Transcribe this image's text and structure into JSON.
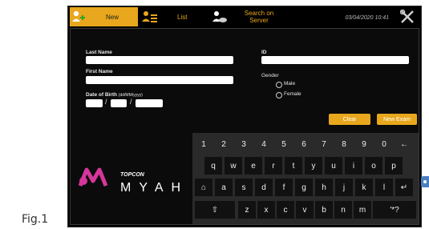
{
  "figure_label": "Fig.1",
  "tabs": [
    {
      "label": "New",
      "icon": "add-user-icon"
    },
    {
      "label": "List",
      "icon": "user-list-icon"
    },
    {
      "label": "Search on\nServer",
      "icon": "search-server-icon"
    }
  ],
  "datetime": "03/04/2020 10:41",
  "form": {
    "last_name_label": "Last Name",
    "first_name_label": "First Name",
    "dob_label": "Date of Birth",
    "dob_format": "(dd/MM/yyyy)",
    "dob_sep1": "/",
    "dob_sep2": "/",
    "id_label": "ID",
    "gender_label": "Gender",
    "male_label": "Male",
    "female_label": "Female",
    "clear_button": "Clear",
    "new_exam_button": "New Exam"
  },
  "keyboard": {
    "row1": [
      "1",
      "2",
      "3",
      "4",
      "5",
      "6",
      "7",
      "8",
      "9",
      "0",
      "←"
    ],
    "row2": [
      "q",
      "w",
      "e",
      "r",
      "t",
      "y",
      "u",
      "i",
      "o",
      "p"
    ],
    "row3": [
      "⌂",
      "a",
      "s",
      "d",
      "f",
      "g",
      "h",
      "j",
      "k",
      "l",
      "↵"
    ],
    "row4": [
      "⇧",
      "z",
      "x",
      "c",
      "v",
      "b",
      "n",
      "m",
      "'*?"
    ]
  },
  "brand": {
    "company": "TOPCON",
    "product": "MYAH"
  },
  "colors": {
    "accent": "#e8a71c",
    "logo_magenta": "#d6369a",
    "background": "#000000"
  }
}
